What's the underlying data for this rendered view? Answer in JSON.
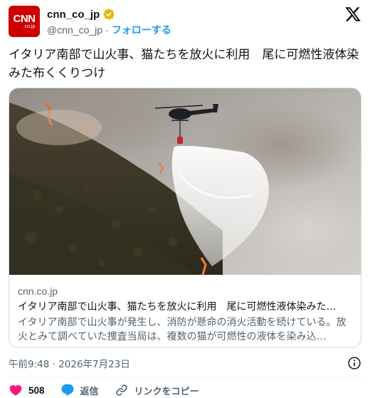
{
  "account": {
    "avatar_text": "CNN",
    "avatar_subtext": ".co.jp",
    "display_name": "cnn_co_jp",
    "handle": "@cnn_co_jp",
    "separator": "·",
    "follow_label": "フォローする"
  },
  "tweet": {
    "text": "イタリア南部で山火事、猫たちを放火に利用　尾に可燃性液体染みた布くくりつけ"
  },
  "card": {
    "domain": "cnn.co.jp",
    "title": "イタリア南部で山火事、猫たちを放火に利用　尾に可燃性液体染みた…",
    "description": "イタリア南部で山火事が発生し、消防が懸命の消火活動を続けている。放火とみて調べていた捜査当局は、複数の猫が可燃性の液体を染み込…"
  },
  "meta": {
    "timestamp": "午前9:48 · 2026年7月23日"
  },
  "actions": {
    "like_count": "508",
    "reply_label": "返信",
    "copy_link_label": "リンクをコピー"
  },
  "colors": {
    "brand_red": "#cc0000",
    "link_blue": "#1d9bf0",
    "like_pink": "#f91880",
    "verified_gold": "#e2b719",
    "secondary_text": "#536471"
  }
}
